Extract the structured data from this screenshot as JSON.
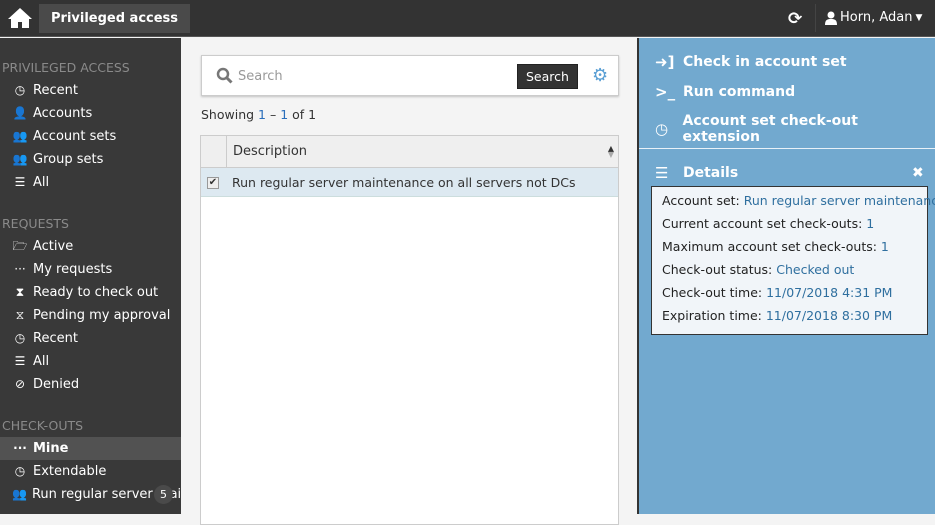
{
  "topbar": {
    "app_tab": "Privileged access",
    "user_name": "Horn, Adan",
    "icons": {
      "home": "home-icon",
      "refresh": "refresh-icon",
      "user": "user-icon",
      "caret": "caret-down-icon"
    }
  },
  "sidebar": {
    "sections": [
      {
        "title": "PRIVILEGED ACCESS",
        "items": [
          {
            "label": "Recent",
            "icon": "clock-icon"
          },
          {
            "label": "Accounts",
            "icon": "user-icon"
          },
          {
            "label": "Account sets",
            "icon": "users-icon"
          },
          {
            "label": "Group sets",
            "icon": "users-icon"
          },
          {
            "label": "All",
            "icon": "list-icon"
          }
        ]
      },
      {
        "title": "REQUESTS",
        "items": [
          {
            "label": "Active",
            "icon": "folder-open-icon"
          },
          {
            "label": "My requests",
            "icon": "ellipsis-icon"
          },
          {
            "label": "Ready to check out",
            "icon": "hourglass-icon"
          },
          {
            "label": "Pending my approval",
            "icon": "hourglass-empty-icon"
          },
          {
            "label": "Recent",
            "icon": "clock-icon"
          },
          {
            "label": "All",
            "icon": "list-icon"
          },
          {
            "label": "Denied",
            "icon": "ban-icon"
          }
        ]
      },
      {
        "title": "CHECK-OUTS",
        "items": [
          {
            "label": "Mine",
            "icon": "ellipsis-icon",
            "active": true
          },
          {
            "label": "Extendable",
            "icon": "clock-icon"
          },
          {
            "label": "Run regular server maintenance",
            "icon": "users-icon",
            "badge": "5"
          }
        ]
      }
    ]
  },
  "main": {
    "search": {
      "placeholder": "Search",
      "value": "",
      "button": "Search"
    },
    "showing": {
      "prefix": "Showing ",
      "start": "1",
      "dash": " – ",
      "end": "1",
      "of": " of 1"
    },
    "table": {
      "columns": [
        "Description"
      ],
      "rows": [
        {
          "checked": true,
          "description": "Run regular server maintenance on all servers not DCs"
        }
      ]
    }
  },
  "actions": [
    {
      "label": "Check in account set",
      "icon": "sign-in-icon"
    },
    {
      "label": "Run command",
      "icon": "terminal-icon"
    },
    {
      "label": "Account set check-out extension",
      "icon": "clock-icon"
    }
  ],
  "details": {
    "title": "Details",
    "fields": [
      {
        "label": "Account set: ",
        "value": "Run regular server maintenance"
      },
      {
        "label": "Current account set check-outs: ",
        "value": "1"
      },
      {
        "label": "Maximum account set check-outs: ",
        "value": "1"
      },
      {
        "label": "Check-out status: ",
        "value": "Checked out"
      },
      {
        "label": "Check-out time: ",
        "value": "11/07/2018 4:31 PM"
      },
      {
        "label": "Expiration time: ",
        "value": "11/07/2018 8:30 PM"
      }
    ]
  },
  "colors": {
    "topbar": "#333333",
    "sidebar": "#393939",
    "panel": "#72a9cf",
    "row_selected": "#dde9f1",
    "accent": "#5a9fd4"
  }
}
